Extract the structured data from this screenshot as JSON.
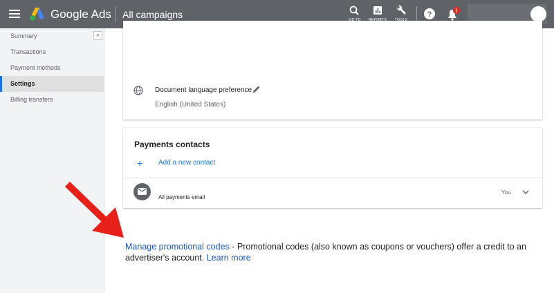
{
  "header": {
    "brand": "Google Ads",
    "breadcrumb": "All campaigns",
    "tools": [
      {
        "icon": "search-icon",
        "label": "GO TO"
      },
      {
        "icon": "reports-icon",
        "label": "REPORTS"
      },
      {
        "icon": "wrench-icon",
        "label": "TOOLS"
      }
    ],
    "notification_badge": "!"
  },
  "sidebar": {
    "collapse_glyph": "«",
    "items": [
      {
        "label": "Summary"
      },
      {
        "label": "Transactions"
      },
      {
        "label": "Payment methods"
      },
      {
        "label": "Settings",
        "active": true
      },
      {
        "label": "Billing transfers"
      }
    ]
  },
  "settings_card": {
    "document_language_label": "Document language preference",
    "document_language_value": "English (United States)"
  },
  "contacts_card": {
    "title": "Payments contacts",
    "add_contact_label": "Add a new contact",
    "contact_label": "All payments email",
    "contact_owner": "You"
  },
  "promo": {
    "link_text": "Manage promotional codes",
    "description": " - Promotional codes (also known as coupons or vouchers) offer a credit to an advertiser's account. ",
    "learn_more": "Learn more"
  },
  "colors": {
    "topbar": "#5f6368",
    "link": "#1a56c8",
    "accent_blue": "#1a73e8",
    "arrow": "#e8201a",
    "badge": "#d93025"
  }
}
